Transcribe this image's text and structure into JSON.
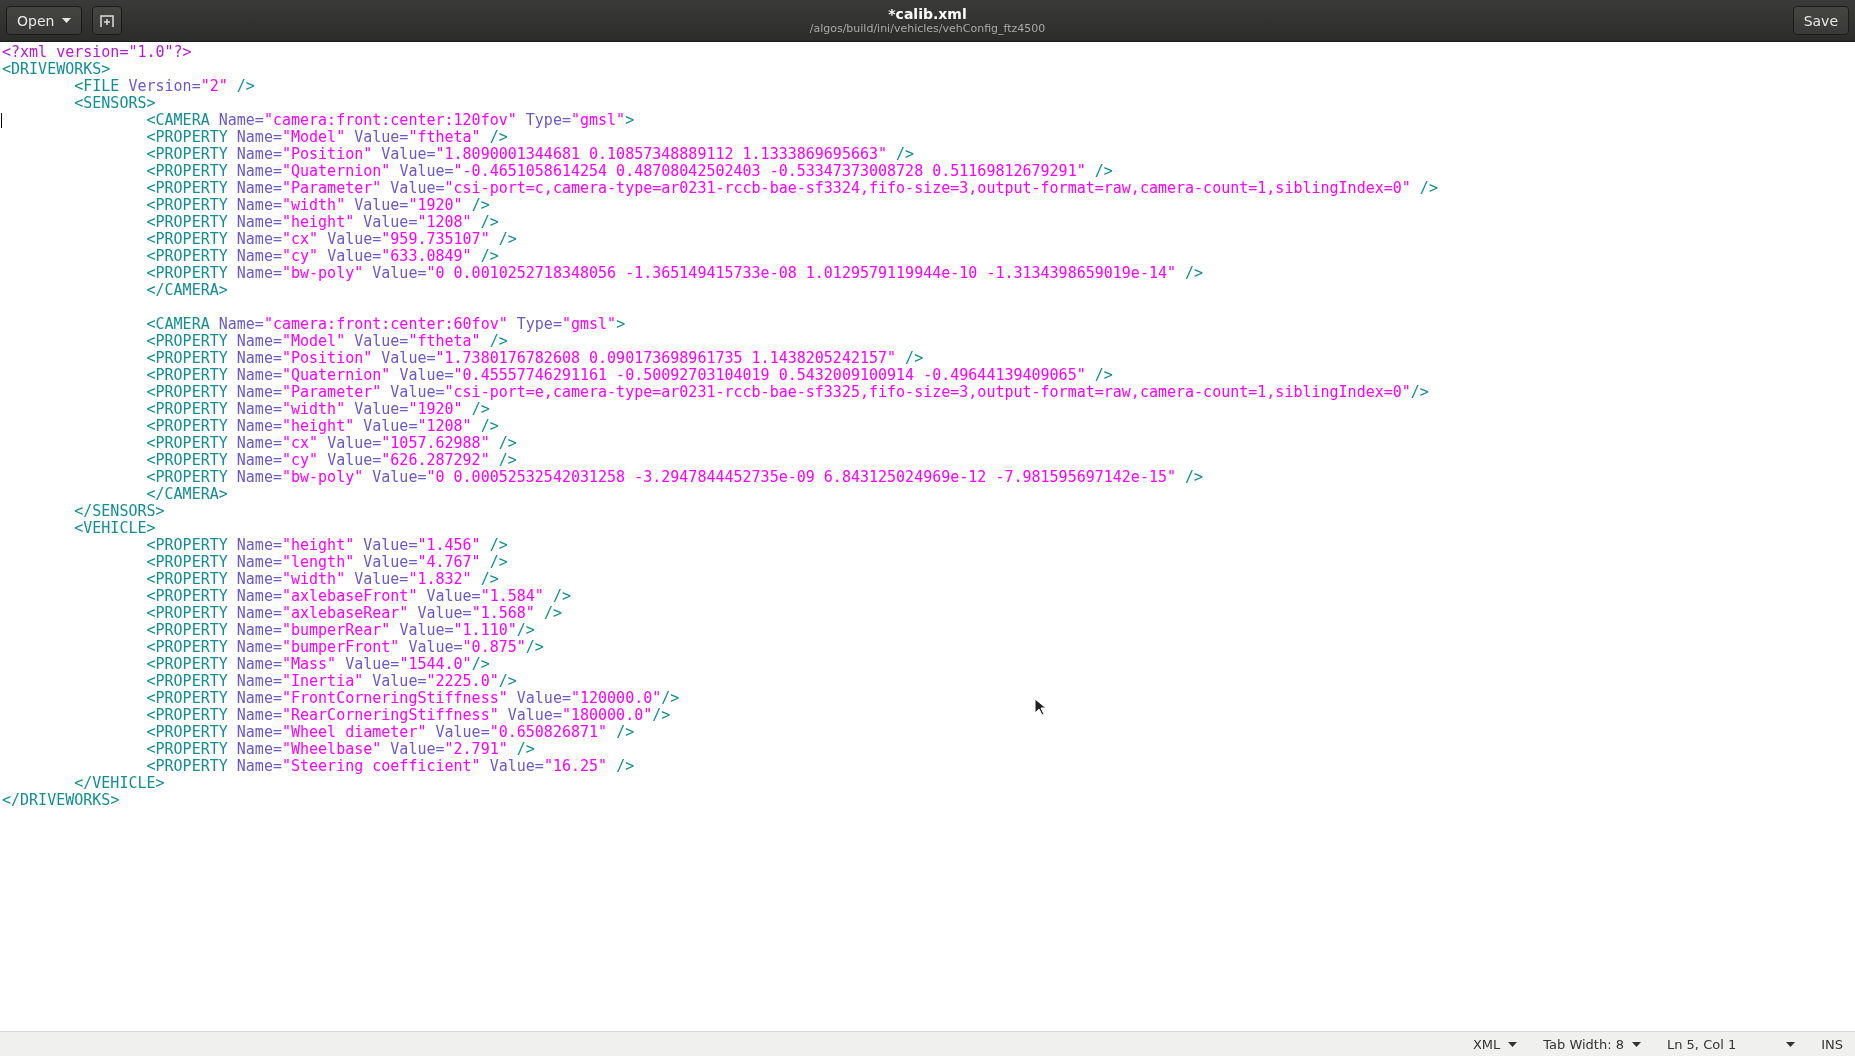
{
  "header": {
    "open_button": "Open",
    "title": "*calib.xml",
    "subtitle": "/algos/build/ini/vehicles/vehConfig_ftz4500",
    "save_button": "Save"
  },
  "editor": {
    "lines": [
      {
        "text": "<?xml version=\"1.0\"?>",
        "caret": false
      },
      {
        "text": "<DRIVEWORKS>",
        "caret": false
      },
      {
        "text": "\t<FILE Version=\"2\" />",
        "caret": false
      },
      {
        "text": "\t<SENSORS>",
        "caret": false
      },
      {
        "text": "\t\t<CAMERA Name=\"camera:front:center:120fov\" Type=\"gmsl\">",
        "caret": true
      },
      {
        "text": "\t\t<PROPERTY Name=\"Model\" Value=\"ftheta\" />",
        "caret": false
      },
      {
        "text": "\t\t<PROPERTY Name=\"Position\" Value=\"1.8090001344681 0.10857348889112 1.1333869695663\" />",
        "caret": false
      },
      {
        "text": "\t\t<PROPERTY Name=\"Quaternion\" Value=\"-0.4651058614254 0.48708042502403 -0.53347373008728 0.51169812679291\" />",
        "caret": false
      },
      {
        "text": "\t\t<PROPERTY Name=\"Parameter\" Value=\"csi-port=c,camera-type=ar0231-rccb-bae-sf3324,fifo-size=3,output-format=raw,camera-count=1,siblingIndex=0\" />",
        "caret": false
      },
      {
        "text": "\t\t<PROPERTY Name=\"width\" Value=\"1920\" />",
        "caret": false
      },
      {
        "text": "\t\t<PROPERTY Name=\"height\" Value=\"1208\" />",
        "caret": false
      },
      {
        "text": "\t\t<PROPERTY Name=\"cx\" Value=\"959.735107\" />",
        "caret": false
      },
      {
        "text": "\t\t<PROPERTY Name=\"cy\" Value=\"633.0849\" />",
        "caret": false
      },
      {
        "text": "\t\t<PROPERTY Name=\"bw-poly\" Value=\"0 0.0010252718348056 -1.365149415733e-08 1.0129579119944e-10 -1.3134398659019e-14\" />",
        "caret": false
      },
      {
        "text": "\t\t</CAMERA>",
        "caret": false
      },
      {
        "caret": false
      },
      {
        "text": "\t\t<CAMERA Name=\"camera:front:center:60fov\" Type=\"gmsl\">",
        "caret": false
      },
      {
        "text": "\t\t<PROPERTY Name=\"Model\" Value=\"ftheta\" />",
        "caret": false
      },
      {
        "text": "\t\t<PROPERTY Name=\"Position\" Value=\"1.7380176782608 0.090173698961735 1.1438205242157\" />",
        "caret": false
      },
      {
        "text": "\t\t<PROPERTY Name=\"Quaternion\" Value=\"0.45557746291161 -0.50092703104019 0.5432009100914 -0.49644139409065\" />",
        "caret": false
      },
      {
        "text": "\t\t<PROPERTY Name=\"Parameter\" Value=\"csi-port=e,camera-type=ar0231-rccb-bae-sf3325,fifo-size=3,output-format=raw,camera-count=1,siblingIndex=0\"/>",
        "caret": false
      },
      {
        "text": "\t\t<PROPERTY Name=\"width\" Value=\"1920\" />",
        "caret": false
      },
      {
        "text": "\t\t<PROPERTY Name=\"height\" Value=\"1208\" />",
        "caret": false
      },
      {
        "text": "\t\t<PROPERTY Name=\"cx\" Value=\"1057.62988\" />",
        "caret": false
      },
      {
        "text": "\t\t<PROPERTY Name=\"cy\" Value=\"626.287292\" />",
        "caret": false
      },
      {
        "text": "\t\t<PROPERTY Name=\"bw-poly\" Value=\"0 0.00052532542031258 -3.2947844452735e-09 6.843125024969e-12 -7.981595697142e-15\" />",
        "caret": false
      },
      {
        "text": "\t\t</CAMERA>",
        "caret": false
      },
      {
        "text": "\t</SENSORS>",
        "caret": false
      },
      {
        "text": "\t<VEHICLE>",
        "caret": false
      },
      {
        "text": "\t\t<PROPERTY Name=\"height\" Value=\"1.456\" />",
        "caret": false
      },
      {
        "text": "\t\t<PROPERTY Name=\"length\" Value=\"4.767\" />",
        "caret": false
      },
      {
        "text": "\t\t<PROPERTY Name=\"width\" Value=\"1.832\" />",
        "caret": false
      },
      {
        "text": "\t\t<PROPERTY Name=\"axlebaseFront\" Value=\"1.584\" />",
        "caret": false
      },
      {
        "text": "\t\t<PROPERTY Name=\"axlebaseRear\" Value=\"1.568\" />",
        "caret": false
      },
      {
        "text": "\t\t<PROPERTY Name=\"bumperRear\" Value=\"1.110\"/>",
        "caret": false
      },
      {
        "text": "\t\t<PROPERTY Name=\"bumperFront\" Value=\"0.875\"/>",
        "caret": false
      },
      {
        "text": "\t\t<PROPERTY Name=\"Mass\" Value=\"1544.0\"/>",
        "caret": false
      },
      {
        "text": "\t\t<PROPERTY Name=\"Inertia\" Value=\"2225.0\"/>",
        "caret": false
      },
      {
        "text": "\t\t<PROPERTY Name=\"FrontCorneringStiffness\" Value=\"120000.0\"/>",
        "caret": false
      },
      {
        "text": "\t\t<PROPERTY Name=\"RearCorneringStiffness\" Value=\"180000.0\"/>",
        "caret": false
      },
      {
        "text": "\t\t<PROPERTY Name=\"Wheel diameter\" Value=\"0.650826871\" />",
        "caret": false
      },
      {
        "text": "\t\t<PROPERTY Name=\"Wheelbase\" Value=\"2.791\" />",
        "caret": false
      },
      {
        "text": "\t\t<PROPERTY Name=\"Steering coefficient\" Value=\"16.25\" />",
        "caret": false
      },
      {
        "text": "\t</VEHICLE>",
        "caret": false
      },
      {
        "text": "</DRIVEWORKS>",
        "caret": false
      }
    ]
  },
  "status_bar": {
    "language": "XML",
    "tab_width": "Tab Width: 8",
    "position": "Ln 5, Col 1",
    "mode": "INS"
  }
}
